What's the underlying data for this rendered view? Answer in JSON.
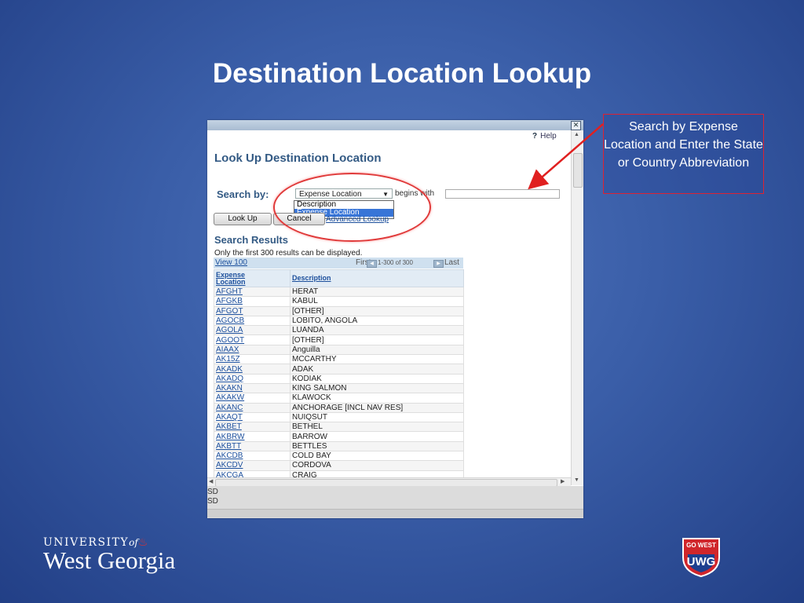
{
  "slide_title": "Destination Location Lookup",
  "window": {
    "close_glyph": "✕",
    "help_icon": "?",
    "help_label": "Help",
    "lookup_title": "Look Up Destination Location",
    "search_by_label": "Search by:",
    "select_value": "Expense Location",
    "begins_with": "begins with",
    "input_value": "",
    "dropdown_options": [
      "Description",
      "Expense Location"
    ],
    "lookup_button": "Look Up",
    "cancel_button": "Cancel",
    "advanced_link": "Advanced Lookup",
    "results_title": "Search Results",
    "results_note": "Only the first 300 results can be displayed.",
    "view_link": "View 100",
    "first_label": "First",
    "range_label": "1-300 of 300",
    "last_label": "Last",
    "col_code_line1": "Expense",
    "col_code_line2": "Location",
    "col_desc": "Description",
    "rows": [
      [
        "AFGHT",
        "HERAT"
      ],
      [
        "AFGKB",
        "KABUL"
      ],
      [
        "AFGOT",
        "[OTHER]"
      ],
      [
        "AGOCB",
        "LOBITO, ANGOLA"
      ],
      [
        "AGOLA",
        "LUANDA"
      ],
      [
        "AGOOT",
        "[OTHER]"
      ],
      [
        "AIAAX",
        "Anguilla"
      ],
      [
        "AK15Z",
        "MCCARTHY"
      ],
      [
        "AKADK",
        "ADAK"
      ],
      [
        "AKADQ",
        "KODIAK"
      ],
      [
        "AKAKN",
        "KING SALMON"
      ],
      [
        "AKAKW",
        "KLAWOCK"
      ],
      [
        "AKANC",
        "ANCHORAGE [INCL NAV RES]"
      ],
      [
        "AKAQT",
        "NUIQSUT"
      ],
      [
        "AKBET",
        "BETHEL"
      ],
      [
        "AKBRW",
        "BARROW"
      ],
      [
        "AKBTT",
        "BETTLES"
      ],
      [
        "AKCDB",
        "COLD BAY"
      ],
      [
        "AKCDV",
        "CORDOVA"
      ],
      [
        "AKCGA",
        "CRAIG"
      ]
    ],
    "bottom_row1": "SD",
    "bottom_row2": "SD"
  },
  "callout_text": "Search by Expense Location and Enter the State or Country Abbreviation",
  "logo": {
    "univ": "UNIVERSITY",
    "of": "of",
    "west_georgia": "West Georgia",
    "badge_top": "GO WEST",
    "badge_main": "UWG"
  },
  "colors": {
    "accent_red": "#e03a3a",
    "title_blue": "#335a84",
    "link_blue": "#1c4f9c"
  }
}
